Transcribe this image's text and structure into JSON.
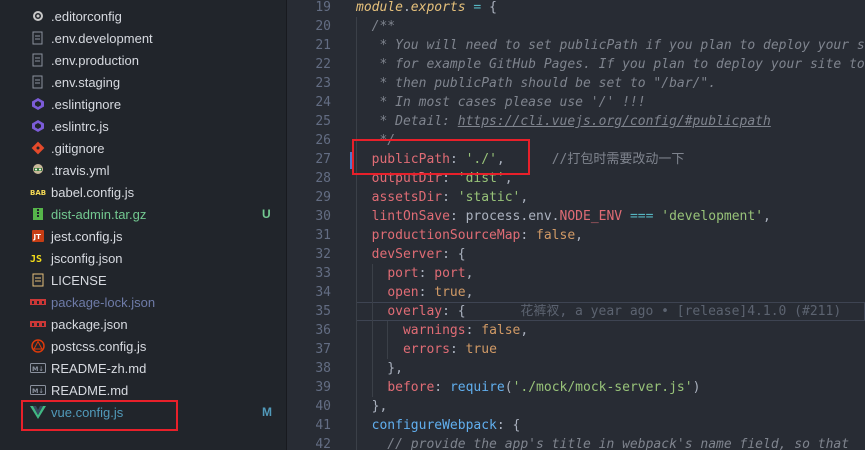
{
  "explorer": {
    "files": [
      {
        "name": ".editorconfig",
        "icon": "gear-icon",
        "color": "#d7dae0",
        "status": ""
      },
      {
        "name": ".env.development",
        "icon": "file-icon",
        "color": "#d7dae0",
        "status": ""
      },
      {
        "name": ".env.production",
        "icon": "file-icon",
        "color": "#d7dae0",
        "status": ""
      },
      {
        "name": ".env.staging",
        "icon": "file-icon",
        "color": "#d7dae0",
        "status": ""
      },
      {
        "name": ".eslintignore",
        "icon": "eslint-icon",
        "color": "#d7dae0",
        "status": ""
      },
      {
        "name": ".eslintrc.js",
        "icon": "eslint-icon",
        "color": "#d7dae0",
        "status": ""
      },
      {
        "name": ".gitignore",
        "icon": "git-icon",
        "color": "#d7dae0",
        "status": ""
      },
      {
        "name": ".travis.yml",
        "icon": "travis-icon",
        "color": "#d7dae0",
        "status": ""
      },
      {
        "name": "babel.config.js",
        "icon": "babel-icon",
        "color": "#d7dae0",
        "status": ""
      },
      {
        "name": "dist-admin.tar.gz",
        "icon": "archive-icon",
        "color": "#73c991",
        "status": "U"
      },
      {
        "name": "jest.config.js",
        "icon": "jest-icon",
        "color": "#d7dae0",
        "status": ""
      },
      {
        "name": "jsconfig.json",
        "icon": "json-icon",
        "color": "#d7dae0",
        "status": ""
      },
      {
        "name": "LICENSE",
        "icon": "license-icon",
        "color": "#d7dae0",
        "status": ""
      },
      {
        "name": "package-lock.json",
        "icon": "npm-icon",
        "color": "#6e7ba8",
        "status": ""
      },
      {
        "name": "package.json",
        "icon": "npm-icon",
        "color": "#d7dae0",
        "status": ""
      },
      {
        "name": "postcss.config.js",
        "icon": "postcss-icon",
        "color": "#d7dae0",
        "status": ""
      },
      {
        "name": "README-zh.md",
        "icon": "markdown-icon",
        "color": "#d7dae0",
        "status": ""
      },
      {
        "name": "README.md",
        "icon": "markdown-icon",
        "color": "#d7dae0",
        "status": ""
      },
      {
        "name": "vue.config.js",
        "icon": "vue-icon",
        "color": "#519aba",
        "status": "M"
      }
    ]
  },
  "editor": {
    "lines": [
      {
        "no": "19",
        "tokens": [
          [
            "mod",
            "module"
          ],
          [
            "plain",
            "."
          ],
          [
            "mod",
            "exports"
          ],
          [
            "plain",
            " "
          ],
          [
            "op",
            "="
          ],
          [
            "plain",
            " {"
          ]
        ]
      },
      {
        "no": "20",
        "tokens": [
          [
            "cm",
            "  /**"
          ]
        ]
      },
      {
        "no": "21",
        "tokens": [
          [
            "cm",
            "   * You will need to set publicPath if you plan to deploy your si"
          ]
        ]
      },
      {
        "no": "22",
        "tokens": [
          [
            "cm",
            "   * for example GitHub Pages. If you plan to deploy your site to"
          ]
        ]
      },
      {
        "no": "23",
        "tokens": [
          [
            "cm",
            "   * then publicPath should be set to \"/bar/\"."
          ]
        ]
      },
      {
        "no": "24",
        "tokens": [
          [
            "cm",
            "   * In most cases please use '/' !!!"
          ]
        ]
      },
      {
        "no": "25",
        "tokens": [
          [
            "cm",
            "   * Detail: "
          ],
          [
            "link",
            "https://cli.vuejs.org/config/#publicpath"
          ]
        ]
      },
      {
        "no": "26",
        "tokens": [
          [
            "cm",
            "   */"
          ]
        ]
      },
      {
        "no": "27",
        "tokens": [
          [
            "plain",
            "  "
          ],
          [
            "key",
            "publicPath"
          ],
          [
            "plain",
            ": "
          ],
          [
            "str",
            "'./'"
          ],
          [
            "plain",
            ",      "
          ],
          [
            "cmchn",
            "//打包时需要改动一下"
          ]
        ]
      },
      {
        "no": "28",
        "tokens": [
          [
            "plain",
            "  "
          ],
          [
            "key",
            "outputDir"
          ],
          [
            "plain",
            ": "
          ],
          [
            "str",
            "'dist'"
          ],
          [
            "plain",
            ","
          ]
        ]
      },
      {
        "no": "29",
        "tokens": [
          [
            "plain",
            "  "
          ],
          [
            "key",
            "assetsDir"
          ],
          [
            "plain",
            ": "
          ],
          [
            "str",
            "'static'"
          ],
          [
            "plain",
            ","
          ]
        ]
      },
      {
        "no": "30",
        "tokens": [
          [
            "plain",
            "  "
          ],
          [
            "key",
            "lintOnSave"
          ],
          [
            "plain",
            ": process.env."
          ],
          [
            "prop",
            "NODE_ENV"
          ],
          [
            "plain",
            " "
          ],
          [
            "op",
            "==="
          ],
          [
            "plain",
            " "
          ],
          [
            "str",
            "'development'"
          ],
          [
            "plain",
            ","
          ]
        ]
      },
      {
        "no": "31",
        "tokens": [
          [
            "plain",
            "  "
          ],
          [
            "key",
            "productionSourceMap"
          ],
          [
            "plain",
            ": "
          ],
          [
            "bool",
            "false"
          ],
          [
            "plain",
            ","
          ]
        ]
      },
      {
        "no": "32",
        "tokens": [
          [
            "plain",
            "  "
          ],
          [
            "key",
            "devServer"
          ],
          [
            "plain",
            ": {"
          ]
        ]
      },
      {
        "no": "33",
        "tokens": [
          [
            "plain",
            "    "
          ],
          [
            "key",
            "port"
          ],
          [
            "plain",
            ": "
          ],
          [
            "prop",
            "port"
          ],
          [
            "plain",
            ","
          ]
        ]
      },
      {
        "no": "34",
        "tokens": [
          [
            "plain",
            "    "
          ],
          [
            "key",
            "open"
          ],
          [
            "plain",
            ": "
          ],
          [
            "bool",
            "true"
          ],
          [
            "plain",
            ","
          ]
        ]
      },
      {
        "no": "35",
        "tokens": [
          [
            "plain",
            "    "
          ],
          [
            "key",
            "overlay"
          ],
          [
            "plain",
            ": {"
          ],
          [
            "blame",
            "       花裤衩, a year ago • [release]4.1.0 (#211)"
          ]
        ]
      },
      {
        "no": "36",
        "tokens": [
          [
            "plain",
            "      "
          ],
          [
            "key",
            "warnings"
          ],
          [
            "plain",
            ": "
          ],
          [
            "bool",
            "false"
          ],
          [
            "plain",
            ","
          ]
        ]
      },
      {
        "no": "37",
        "tokens": [
          [
            "plain",
            "      "
          ],
          [
            "key",
            "errors"
          ],
          [
            "plain",
            ": "
          ],
          [
            "bool",
            "true"
          ]
        ]
      },
      {
        "no": "38",
        "tokens": [
          [
            "plain",
            "    },"
          ]
        ]
      },
      {
        "no": "39",
        "tokens": [
          [
            "plain",
            "    "
          ],
          [
            "key",
            "before"
          ],
          [
            "plain",
            ": "
          ],
          [
            "fn",
            "require"
          ],
          [
            "plain",
            "("
          ],
          [
            "str",
            "'./mock/mock-server.js'"
          ],
          [
            "plain",
            ")"
          ]
        ]
      },
      {
        "no": "40",
        "tokens": [
          [
            "plain",
            "  },"
          ]
        ]
      },
      {
        "no": "41",
        "tokens": [
          [
            "plain",
            "  "
          ],
          [
            "fn",
            "configureWebpack"
          ],
          [
            "plain",
            ": {"
          ]
        ]
      },
      {
        "no": "42",
        "tokens": [
          [
            "cm",
            "    // provide the app's title in webpack's name field, so that"
          ]
        ]
      }
    ]
  }
}
